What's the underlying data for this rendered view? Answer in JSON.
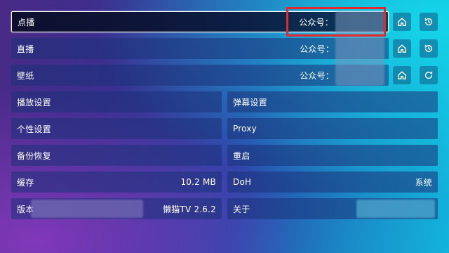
{
  "rows": {
    "vod": {
      "label": "点播",
      "value": "公众号："
    },
    "live": {
      "label": "直播",
      "value": "公众号："
    },
    "wallpaper": {
      "label": "壁纸",
      "value": "公众号："
    }
  },
  "grid": {
    "playback_settings": {
      "label": "播放设置"
    },
    "danmaku_settings": {
      "label": "弹幕设置"
    },
    "personalization": {
      "label": "个性设置"
    },
    "proxy": {
      "label": "Proxy"
    },
    "backup_restore": {
      "label": "备份恢复"
    },
    "restart": {
      "label": "重启"
    },
    "cache": {
      "label": "缓存",
      "value": "10.2 MB"
    },
    "doh": {
      "label": "DoH",
      "value": "系统"
    },
    "version": {
      "label": "版本",
      "value": "懒猫TV 2.6.2"
    },
    "about": {
      "label": "关于"
    }
  },
  "icons": {
    "vod_home": "home-icon",
    "vod_history": "history-icon",
    "live_home": "home-icon",
    "live_history": "history-icon",
    "wall_home": "home-icon",
    "wall_refresh": "refresh-icon"
  },
  "colors": {
    "highlight_box": "#e8272a",
    "icon_button": "#1278a0"
  }
}
